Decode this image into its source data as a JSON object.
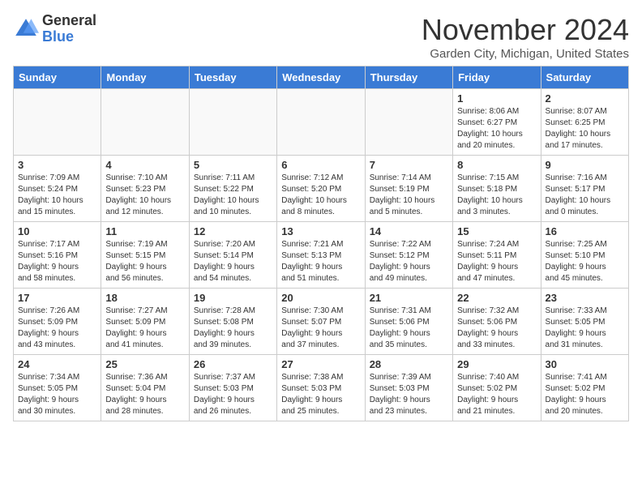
{
  "header": {
    "logo_general": "General",
    "logo_blue": "Blue",
    "month_title": "November 2024",
    "location": "Garden City, Michigan, United States"
  },
  "weekdays": [
    "Sunday",
    "Monday",
    "Tuesday",
    "Wednesday",
    "Thursday",
    "Friday",
    "Saturday"
  ],
  "weeks": [
    [
      {
        "day": "",
        "info": ""
      },
      {
        "day": "",
        "info": ""
      },
      {
        "day": "",
        "info": ""
      },
      {
        "day": "",
        "info": ""
      },
      {
        "day": "",
        "info": ""
      },
      {
        "day": "1",
        "info": "Sunrise: 8:06 AM\nSunset: 6:27 PM\nDaylight: 10 hours\nand 20 minutes."
      },
      {
        "day": "2",
        "info": "Sunrise: 8:07 AM\nSunset: 6:25 PM\nDaylight: 10 hours\nand 17 minutes."
      }
    ],
    [
      {
        "day": "3",
        "info": "Sunrise: 7:09 AM\nSunset: 5:24 PM\nDaylight: 10 hours\nand 15 minutes."
      },
      {
        "day": "4",
        "info": "Sunrise: 7:10 AM\nSunset: 5:23 PM\nDaylight: 10 hours\nand 12 minutes."
      },
      {
        "day": "5",
        "info": "Sunrise: 7:11 AM\nSunset: 5:22 PM\nDaylight: 10 hours\nand 10 minutes."
      },
      {
        "day": "6",
        "info": "Sunrise: 7:12 AM\nSunset: 5:20 PM\nDaylight: 10 hours\nand 8 minutes."
      },
      {
        "day": "7",
        "info": "Sunrise: 7:14 AM\nSunset: 5:19 PM\nDaylight: 10 hours\nand 5 minutes."
      },
      {
        "day": "8",
        "info": "Sunrise: 7:15 AM\nSunset: 5:18 PM\nDaylight: 10 hours\nand 3 minutes."
      },
      {
        "day": "9",
        "info": "Sunrise: 7:16 AM\nSunset: 5:17 PM\nDaylight: 10 hours\nand 0 minutes."
      }
    ],
    [
      {
        "day": "10",
        "info": "Sunrise: 7:17 AM\nSunset: 5:16 PM\nDaylight: 9 hours\nand 58 minutes."
      },
      {
        "day": "11",
        "info": "Sunrise: 7:19 AM\nSunset: 5:15 PM\nDaylight: 9 hours\nand 56 minutes."
      },
      {
        "day": "12",
        "info": "Sunrise: 7:20 AM\nSunset: 5:14 PM\nDaylight: 9 hours\nand 54 minutes."
      },
      {
        "day": "13",
        "info": "Sunrise: 7:21 AM\nSunset: 5:13 PM\nDaylight: 9 hours\nand 51 minutes."
      },
      {
        "day": "14",
        "info": "Sunrise: 7:22 AM\nSunset: 5:12 PM\nDaylight: 9 hours\nand 49 minutes."
      },
      {
        "day": "15",
        "info": "Sunrise: 7:24 AM\nSunset: 5:11 PM\nDaylight: 9 hours\nand 47 minutes."
      },
      {
        "day": "16",
        "info": "Sunrise: 7:25 AM\nSunset: 5:10 PM\nDaylight: 9 hours\nand 45 minutes."
      }
    ],
    [
      {
        "day": "17",
        "info": "Sunrise: 7:26 AM\nSunset: 5:09 PM\nDaylight: 9 hours\nand 43 minutes."
      },
      {
        "day": "18",
        "info": "Sunrise: 7:27 AM\nSunset: 5:09 PM\nDaylight: 9 hours\nand 41 minutes."
      },
      {
        "day": "19",
        "info": "Sunrise: 7:28 AM\nSunset: 5:08 PM\nDaylight: 9 hours\nand 39 minutes."
      },
      {
        "day": "20",
        "info": "Sunrise: 7:30 AM\nSunset: 5:07 PM\nDaylight: 9 hours\nand 37 minutes."
      },
      {
        "day": "21",
        "info": "Sunrise: 7:31 AM\nSunset: 5:06 PM\nDaylight: 9 hours\nand 35 minutes."
      },
      {
        "day": "22",
        "info": "Sunrise: 7:32 AM\nSunset: 5:06 PM\nDaylight: 9 hours\nand 33 minutes."
      },
      {
        "day": "23",
        "info": "Sunrise: 7:33 AM\nSunset: 5:05 PM\nDaylight: 9 hours\nand 31 minutes."
      }
    ],
    [
      {
        "day": "24",
        "info": "Sunrise: 7:34 AM\nSunset: 5:05 PM\nDaylight: 9 hours\nand 30 minutes."
      },
      {
        "day": "25",
        "info": "Sunrise: 7:36 AM\nSunset: 5:04 PM\nDaylight: 9 hours\nand 28 minutes."
      },
      {
        "day": "26",
        "info": "Sunrise: 7:37 AM\nSunset: 5:03 PM\nDaylight: 9 hours\nand 26 minutes."
      },
      {
        "day": "27",
        "info": "Sunrise: 7:38 AM\nSunset: 5:03 PM\nDaylight: 9 hours\nand 25 minutes."
      },
      {
        "day": "28",
        "info": "Sunrise: 7:39 AM\nSunset: 5:03 PM\nDaylight: 9 hours\nand 23 minutes."
      },
      {
        "day": "29",
        "info": "Sunrise: 7:40 AM\nSunset: 5:02 PM\nDaylight: 9 hours\nand 21 minutes."
      },
      {
        "day": "30",
        "info": "Sunrise: 7:41 AM\nSunset: 5:02 PM\nDaylight: 9 hours\nand 20 minutes."
      }
    ]
  ]
}
